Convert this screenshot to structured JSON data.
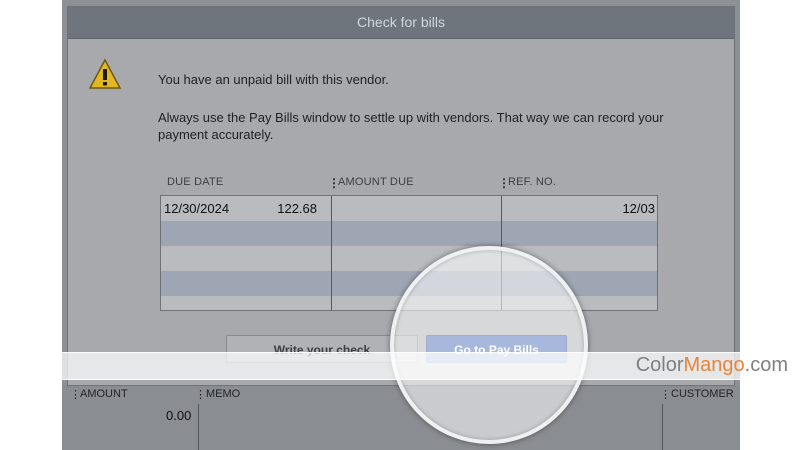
{
  "dialog": {
    "title": "Check for bills",
    "icon": "warning-icon",
    "message_line1": "You have an unpaid bill with this vendor.",
    "message_line2": "Always use the Pay Bills window to settle up with vendors. That way we can record your payment accurately."
  },
  "bills_table": {
    "columns": [
      "DUE DATE",
      "AMOUNT DUE",
      "REF. NO."
    ],
    "rows": [
      {
        "due_date": "12/30/2024",
        "amount_due": "122.68",
        "ref_no": "12/03"
      }
    ]
  },
  "buttons": {
    "write_check": "Write your check",
    "go_to_pay_bills": "Go to Pay Bills"
  },
  "lower_table": {
    "col_amount": "AMOUNT",
    "col_memo": "MEMO",
    "col_customer": "CUSTOMER",
    "amount_value": "0.00"
  },
  "watermark": {
    "part1": "Color",
    "part2": "Mango",
    "part3": ".com"
  },
  "colors": {
    "accent_button": "#3d63b2",
    "titlebar": "#6e757d",
    "brand_orange": "#e8843a"
  }
}
